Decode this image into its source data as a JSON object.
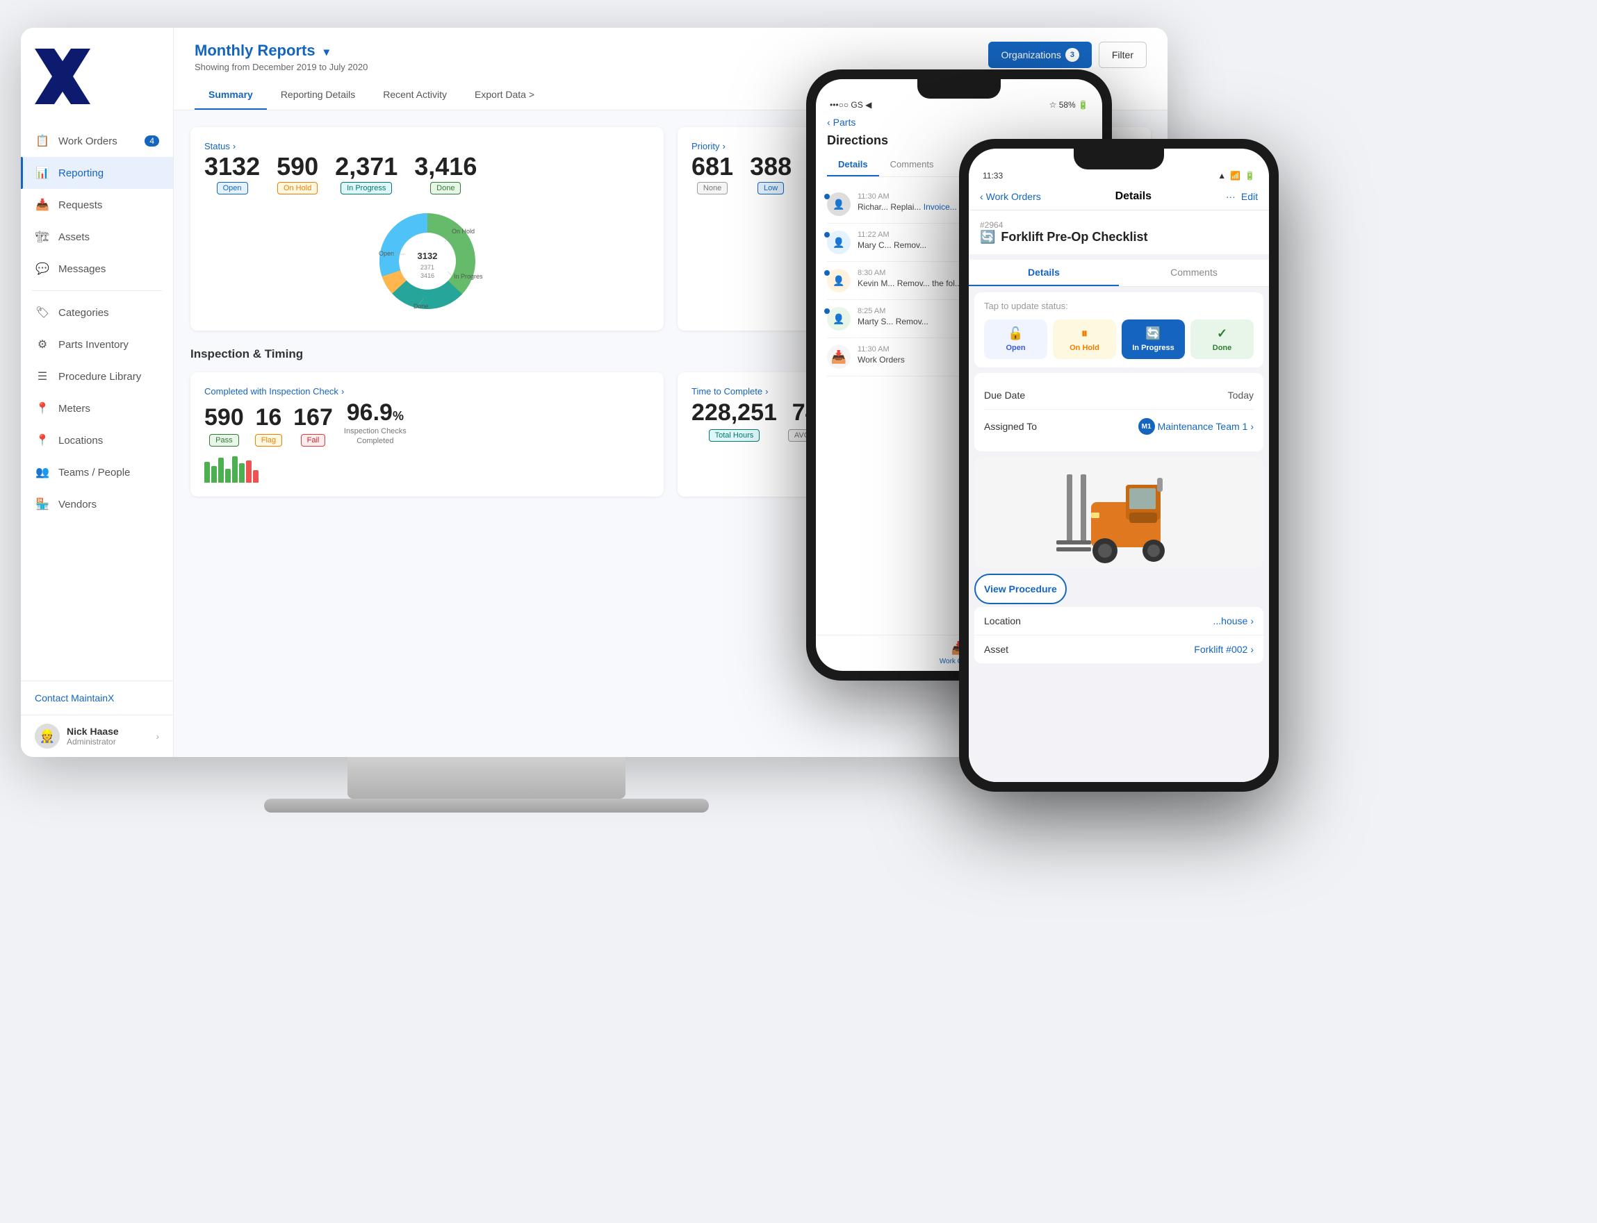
{
  "app": {
    "name": "MaintainX"
  },
  "sidebar": {
    "logo_alt": "MaintainX Logo",
    "nav_items": [
      {
        "id": "work-orders",
        "label": "Work Orders",
        "icon": "📋",
        "badge": "4",
        "active": false
      },
      {
        "id": "reporting",
        "label": "Reporting",
        "icon": "📊",
        "badge": null,
        "active": true
      },
      {
        "id": "requests",
        "label": "Requests",
        "icon": "📥",
        "badge": null,
        "active": false
      },
      {
        "id": "assets",
        "label": "Assets",
        "icon": "🏗",
        "badge": null,
        "active": false
      },
      {
        "id": "messages",
        "label": "Messages",
        "icon": "💬",
        "badge": null,
        "active": false
      }
    ],
    "secondary_items": [
      {
        "id": "categories",
        "label": "Categories",
        "icon": "🏷"
      },
      {
        "id": "parts-inventory",
        "label": "Parts Inventory",
        "icon": "⚙"
      },
      {
        "id": "procedure-library",
        "label": "Procedure Library",
        "icon": "☰"
      },
      {
        "id": "meters",
        "label": "Meters",
        "icon": "📍"
      },
      {
        "id": "locations",
        "label": "Locations",
        "icon": "📍"
      },
      {
        "id": "teams-people",
        "label": "Teams / People",
        "icon": "👥"
      },
      {
        "id": "vendors",
        "label": "Vendors",
        "icon": "🏪"
      }
    ],
    "contact_label": "Contact MaintainX",
    "user": {
      "name": "Nick Haase",
      "role": "Administrator",
      "avatar": "👷"
    }
  },
  "header": {
    "title": "Monthly Reports",
    "subtitle": "Showing from December 2019 to July 2020",
    "organizations_label": "Organizations",
    "organizations_count": "3",
    "filter_label": "Filter",
    "tabs": [
      {
        "id": "summary",
        "label": "Summary",
        "active": true
      },
      {
        "id": "reporting-details",
        "label": "Reporting Details",
        "active": false
      },
      {
        "id": "recent-activity",
        "label": "Recent Activity",
        "active": false
      },
      {
        "id": "export-data",
        "label": "Export Data >",
        "active": false
      }
    ]
  },
  "status_section": {
    "title": "Status",
    "stats": [
      {
        "value": "3132",
        "label": "Open",
        "badge_class": "badge-blue"
      },
      {
        "value": "590",
        "label": "On Hold",
        "badge_class": "badge-yellow"
      },
      {
        "value": "2,371",
        "label": "In Progress",
        "badge_class": "badge-teal"
      },
      {
        "value": "3,416",
        "label": "Done",
        "badge_class": "badge-green"
      }
    ],
    "donut_data": [
      {
        "label": "Open",
        "value": 3132,
        "color": "#4fc3f7",
        "pct": 31
      },
      {
        "label": "On Hold",
        "value": 590,
        "color": "#ffb74d",
        "pct": 6
      },
      {
        "label": "In Progress",
        "value": 2371,
        "color": "#26a69a",
        "pct": 24
      },
      {
        "label": "Done",
        "value": 3416,
        "color": "#66bb6a",
        "pct": 34
      }
    ]
  },
  "priority_section": {
    "title": "Priority",
    "stats": [
      {
        "value": "681",
        "label": "None",
        "badge_class": "badge-gray"
      },
      {
        "value": "388",
        "label": "Low",
        "badge_class": "badge-blue"
      }
    ]
  },
  "inspection_section": {
    "title": "Inspection & Timing",
    "completed": {
      "title": "Completed with Inspection Check",
      "stats": [
        {
          "value": "590",
          "label": "Pass",
          "badge_class": "badge-green"
        },
        {
          "value": "16",
          "label": "Flag",
          "badge_class": "badge-yellow"
        },
        {
          "value": "167",
          "label": "Fail",
          "badge_class": "badge-red"
        }
      ],
      "extra": {
        "value": "96.9",
        "suffix": "%",
        "label": "Inspection Checks Completed"
      }
    },
    "time_to_complete": {
      "title": "Time to Complete",
      "total_hours": "228,251",
      "total_label": "Total Hours",
      "avg_value": "74"
    }
  },
  "phone_back": {
    "status_bar_left": "•••○○ GS ◀",
    "status_bar_right": "☆ 58% 🔋",
    "nav_title": "Parts",
    "section_label": "Directions",
    "tabs": [
      "Details",
      "Comments"
    ],
    "activity": [
      {
        "time": "11:30 AM",
        "user": "Richar...",
        "text": "Replai...",
        "link": "Invoice..."
      },
      {
        "time": "11:22 AM",
        "user": "Mary C...",
        "text": "Remov..."
      },
      {
        "time": "8:30 AM",
        "user": "Kevin M...",
        "text": "Remov...",
        "extra": "the fol..."
      },
      {
        "time": "8:25 AM",
        "user": "Marty S...",
        "text": "Remov..."
      },
      {
        "time": "11:30 AM",
        "icon": "📥"
      }
    ],
    "bottom_nav": [
      {
        "icon": "📥",
        "label": "Work Orders",
        "active": true
      }
    ]
  },
  "phone_front": {
    "status_bar_time": "11:33",
    "status_bar_right": "▲ 📶 🔋",
    "nav_back": "Work Orders",
    "nav_title": "Details",
    "nav_more": "···",
    "nav_edit": "Edit",
    "wo_number": "#2964",
    "wo_title": "Forklift Pre-Op Checklist",
    "tabs": [
      "Details",
      "Comments"
    ],
    "status_label": "Tap to update status:",
    "status_buttons": [
      {
        "id": "open",
        "icon": "🔓",
        "label": "Open",
        "class": "btn-open"
      },
      {
        "id": "hold",
        "icon": "⏸",
        "label": "On Hold",
        "class": "btn-hold"
      },
      {
        "id": "inprogress",
        "icon": "🔄",
        "label": "In Progress",
        "class": "btn-inprogress"
      },
      {
        "id": "done",
        "icon": "✓",
        "label": "Done",
        "class": "btn-done"
      }
    ],
    "fields": [
      {
        "label": "Due Date",
        "value": "Today",
        "has_arrow": false
      },
      {
        "label": "Assigned To",
        "value": "Maintenance Team 1",
        "badge": "M1",
        "has_arrow": true
      }
    ],
    "view_procedure_label": "View Procedure",
    "bottom_fields": [
      {
        "label": "Location",
        "value": "...house",
        "has_arrow": true
      },
      {
        "label": "Asset",
        "value": "Forklift #002",
        "has_arrow": true
      }
    ]
  }
}
